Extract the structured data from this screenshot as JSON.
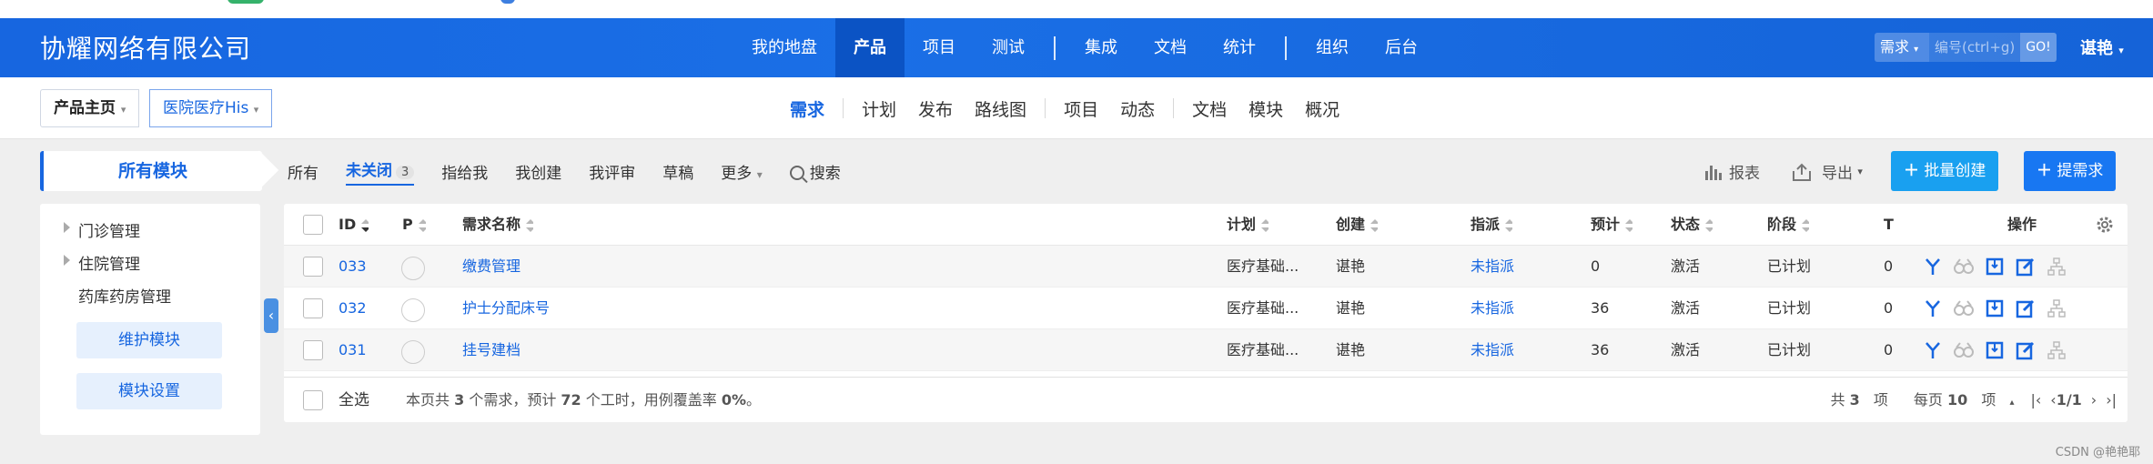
{
  "header": {
    "brand": "协耀网络有限公司",
    "nav": [
      "我的地盘",
      "产品",
      "项目",
      "测试",
      "集成",
      "文档",
      "统计",
      "组织",
      "后台"
    ],
    "search_type": "需求",
    "search_placeholder": "编号(ctrl+g)",
    "search_go": "GO!",
    "user": "谌艳"
  },
  "subheader": {
    "crumb_home": "产品主页",
    "crumb_product": "医院医疗His",
    "nav": [
      "需求",
      "计划",
      "发布",
      "路线图",
      "项目",
      "动态",
      "文档",
      "模块",
      "概况"
    ]
  },
  "sidebar": {
    "title": "所有模块",
    "items": [
      "门诊管理",
      "住院管理",
      "药库药房管理"
    ],
    "btn_maintain": "维护模块",
    "btn_settings": "模块设置"
  },
  "filters": {
    "all": "所有",
    "unclosed": "未关闭",
    "unclosed_count": "3",
    "assigned": "指给我",
    "created": "我创建",
    "reviewing": "我评审",
    "draft": "草稿",
    "more": "更多",
    "search": "搜索"
  },
  "actions": {
    "report": "报表",
    "export": "导出",
    "batch_create": "批量创建",
    "propose": "提需求"
  },
  "table": {
    "headers": {
      "id": "ID",
      "p": "P",
      "name": "需求名称",
      "plan": "计划",
      "creator": "创建",
      "assignee": "指派",
      "estimate": "预计",
      "status": "状态",
      "stage": "阶段",
      "t": "T",
      "ops": "操作"
    },
    "rows": [
      {
        "id": "033",
        "name": "缴费管理",
        "plan": "医疗基础...",
        "creator": "谌艳",
        "assignee": "未指派",
        "estimate": "0",
        "status": "激活",
        "stage": "已计划",
        "t": "0"
      },
      {
        "id": "032",
        "name": "护士分配床号",
        "plan": "医疗基础...",
        "creator": "谌艳",
        "assignee": "未指派",
        "estimate": "36",
        "status": "激活",
        "stage": "已计划",
        "t": "0"
      },
      {
        "id": "031",
        "name": "挂号建档",
        "plan": "医疗基础...",
        "creator": "谌艳",
        "assignee": "未指派",
        "estimate": "36",
        "status": "激活",
        "stage": "已计划",
        "t": "0"
      }
    ]
  },
  "footer": {
    "select_all": "全选",
    "summary_pre": "本页共 ",
    "summary_count": "3",
    "summary_mid1": " 个需求，预计 ",
    "summary_hours": "72",
    "summary_mid2": " 个工时，用例覆盖率 ",
    "summary_cov": "0%",
    "summary_end": "。",
    "total_pre": "共 ",
    "total": "3",
    "total_post": " 项",
    "per_page_pre": "每页 ",
    "per_page": "10",
    "per_page_post": " 项",
    "page": "1/1"
  },
  "watermark": "CSDN @艳艳耶",
  "colors": {
    "primary": "#1766e0",
    "batch": "#19a0f0"
  }
}
